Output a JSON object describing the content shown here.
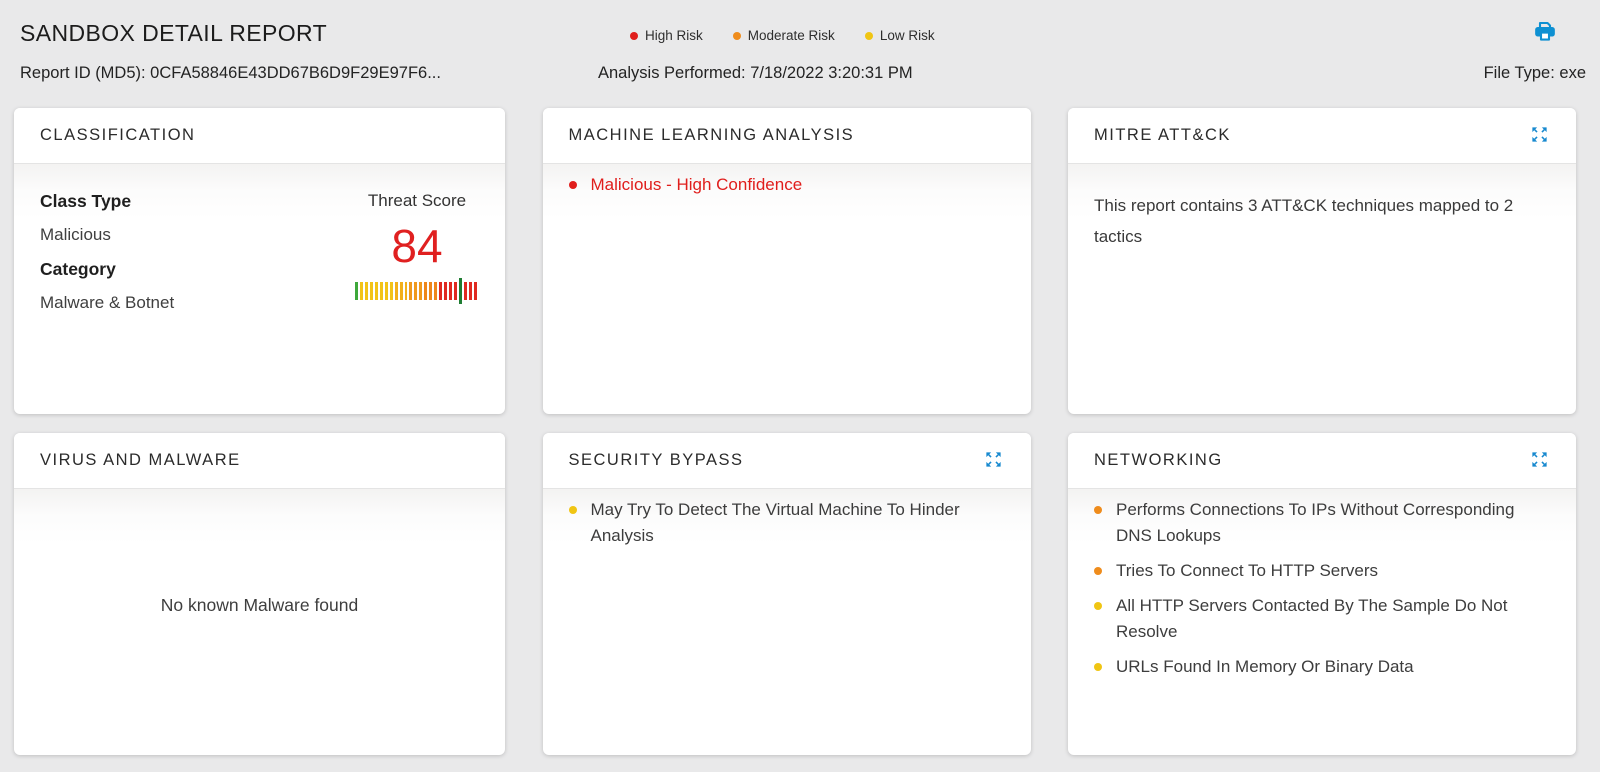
{
  "header": {
    "title": "SANDBOX DETAIL REPORT",
    "report_id": "Report ID (MD5): 0CFA58846E43DD67B6D9F29E97F6...",
    "analysis_performed": "Analysis Performed: 7/18/2022 3:20:31 PM",
    "file_type": "File Type: exe",
    "print_icon": "printer-icon",
    "legend": [
      {
        "label": "High Risk",
        "color": "#e01e1c"
      },
      {
        "label": "Moderate Risk",
        "color": "#ef8c1c"
      },
      {
        "label": "Low Risk",
        "color": "#f0c513"
      }
    ]
  },
  "colors": {
    "accent_blue": "#0e90d2",
    "risk": {
      "high": "#e01e1c",
      "moderate": "#ef8c1c",
      "low": "#f0c513"
    },
    "score_red": "#e02020",
    "marker_green": "#1e7d32",
    "background": "#e9e9ea"
  },
  "cards": {
    "classification": {
      "title": "CLASSIFICATION",
      "fields": [
        {
          "label": "Class Type",
          "value": "Malicious"
        },
        {
          "label": "Category",
          "value": "Malware & Botnet"
        }
      ],
      "threat_score_label": "Threat Score",
      "threat_score": "84",
      "gauge": {
        "marker_index": 21,
        "marker_color": "#1e7d32",
        "bars": [
          "#3ea83b",
          "#f2c318",
          "#f2c318",
          "#f2c318",
          "#f2c318",
          "#f2c318",
          "#f2c318",
          "#f2c318",
          "#f2b01b",
          "#f2b01b",
          "#f2b01b",
          "#f0991e",
          "#f0991e",
          "#f0991e",
          "#ee861b",
          "#ee861b",
          "#ee861b",
          "#e02a20",
          "#e02a20",
          "#e02a20",
          "#e02a20",
          "#e02a20",
          "#e02a20",
          "#e02a20"
        ]
      }
    },
    "machine_learning": {
      "title": "MACHINE LEARNING ANALYSIS",
      "items": [
        {
          "text": "Malicious - High Confidence",
          "risk": "high"
        }
      ]
    },
    "mitre": {
      "title": "MITRE ATT&CK",
      "summary": "This report contains 3 ATT&CK techniques mapped to 2 tactics"
    },
    "virus": {
      "title": "VIRUS AND MALWARE",
      "empty_text": "No known Malware found"
    },
    "security_bypass": {
      "title": "SECURITY BYPASS",
      "items": [
        {
          "text": "May Try To Detect The Virtual Machine To Hinder Analysis",
          "risk": "low"
        }
      ]
    },
    "networking": {
      "title": "NETWORKING",
      "items": [
        {
          "text": "Performs Connections To IPs Without Corresponding DNS Lookups",
          "risk": "moderate"
        },
        {
          "text": "Tries To Connect To HTTP Servers",
          "risk": "moderate"
        },
        {
          "text": "All HTTP Servers Contacted By The Sample Do Not Resolve",
          "risk": "low"
        },
        {
          "text": "URLs Found In Memory Or Binary Data",
          "risk": "low"
        }
      ]
    }
  }
}
